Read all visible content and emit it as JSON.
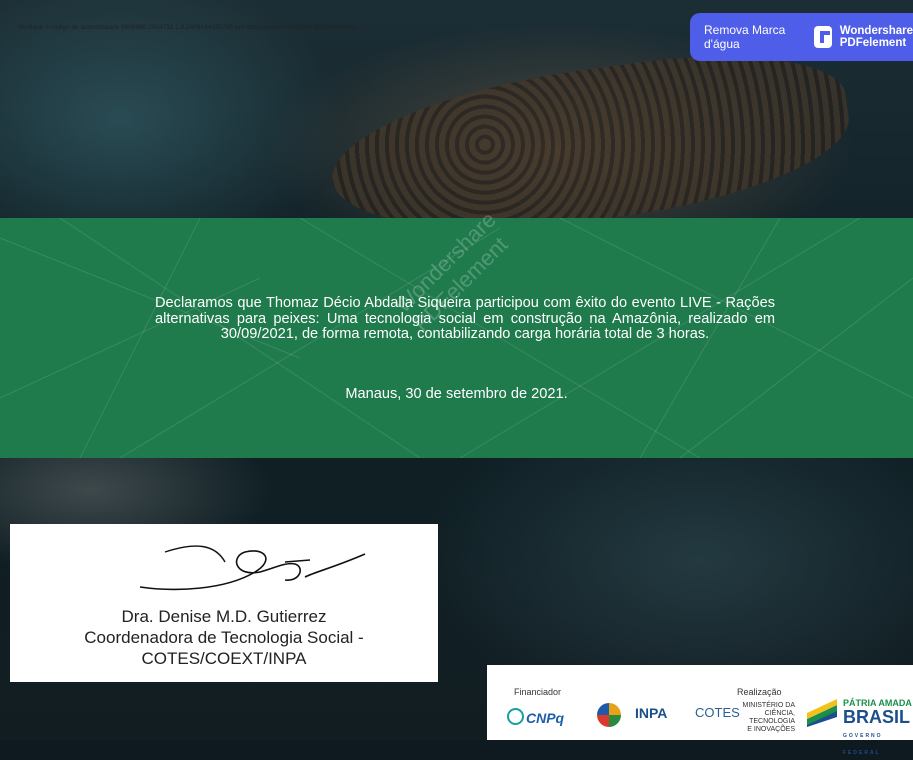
{
  "verification_note": "Verifique o código de autenticidade 6808660.0004733.1.8.2409144435765 em https://www.even3.com.br/documentos",
  "watermark": {
    "remove_label": "Remova Marca d'água",
    "brand_line1": "Wondershare",
    "brand_line2": "PDFelement",
    "diagonal_line1": "Wondershare",
    "diagonal_line2": "PDFelement"
  },
  "certificate": {
    "declaration": "Declaramos que Thomaz Décio Abdalla Siqueira participou com êxito do evento LIVE - Rações alternativas para peixes: Uma tecnologia social em construção na Amazônia, realizado em 30/09/2021, de forma remota, contabilizando carga horária total de 3 horas.",
    "place_date": "Manaus, 30 de setembro de 2021."
  },
  "signatory": {
    "name": "Dra. Denise M.D. Gutierrez",
    "role_line1": "Coordenadora de Tecnologia Social -",
    "role_line2": "COTES/COEXT/INPA"
  },
  "logos": {
    "financiador_label": "Financiador",
    "realizacao_label": "Realização",
    "cnpq": "CNPq",
    "inpa": "INPA",
    "cotes": "COTES",
    "mcti_line1": "MINISTÉRIO DA",
    "mcti_line2": "CIÊNCIA, TECNOLOGIA",
    "mcti_line3": "E INOVAÇÕES",
    "brasil_line1": "PÁTRIA AMADA",
    "brasil_line2": "BRASIL",
    "brasil_line3": "GOVERNO FEDERAL"
  },
  "colors": {
    "band": "#1f7a4c",
    "watermark_banner": "#4f5ee8"
  }
}
